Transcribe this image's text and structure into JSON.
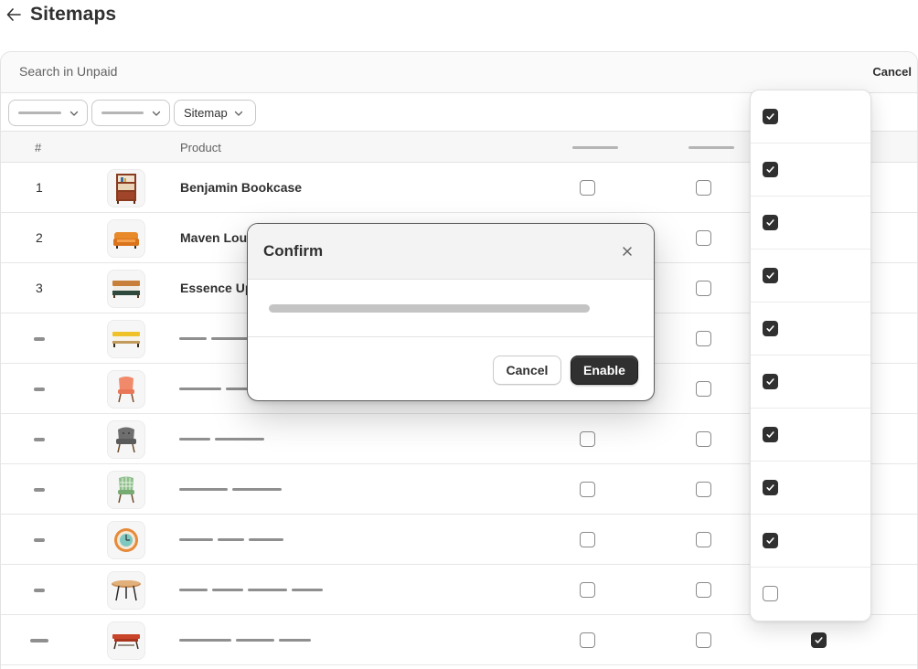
{
  "header": {
    "back_icon": "arrow-left-icon",
    "title": "Sitemaps"
  },
  "search": {
    "placeholder": "Search in Unpaid",
    "cancel_label": "Cancel"
  },
  "filters": [
    {
      "label": ""
    },
    {
      "label": ""
    },
    {
      "label": "Sitemap"
    }
  ],
  "table": {
    "columns": {
      "number": "#",
      "product": "Product"
    },
    "rows": [
      {
        "number": "1",
        "name": "Benjamin Bookcase",
        "thumb": "bookcase",
        "col1_checked": false,
        "col2_checked": false
      },
      {
        "number": "2",
        "name": "Maven Lounge Sofa",
        "thumb": "sofa",
        "col1_checked": false,
        "col2_checked": false
      },
      {
        "number": "3",
        "name": "Essence Upholstered Bed",
        "thumb": "bed-green",
        "col1_checked": false,
        "col2_checked": false
      },
      {
        "number": "",
        "name": "",
        "thumb": "bed-yellow",
        "col1_checked": false,
        "col2_checked": false
      },
      {
        "number": "",
        "name": "",
        "thumb": "chair-pink",
        "col1_checked": false,
        "col2_checked": false
      },
      {
        "number": "",
        "name": "",
        "thumb": "chair-grey",
        "col1_checked": false,
        "col2_checked": false
      },
      {
        "number": "",
        "name": "",
        "thumb": "chair-check",
        "col1_checked": false,
        "col2_checked": false
      },
      {
        "number": "",
        "name": "",
        "thumb": "clock",
        "col1_checked": false,
        "col2_checked": false
      },
      {
        "number": "",
        "name": "",
        "thumb": "table-round",
        "col1_checked": false,
        "col2_checked": false
      },
      {
        "number": "",
        "name": "",
        "thumb": "coffee-table",
        "col1_checked": false,
        "col2_checked": false,
        "col3_checked": true
      }
    ]
  },
  "dropdown": {
    "items": [
      {
        "checked": true
      },
      {
        "checked": true
      },
      {
        "checked": true
      },
      {
        "checked": true
      },
      {
        "checked": true
      },
      {
        "checked": true
      },
      {
        "checked": true
      },
      {
        "checked": true
      },
      {
        "checked": true
      },
      {
        "checked": false
      }
    ]
  },
  "modal": {
    "title": "Confirm",
    "close_icon": "close-icon",
    "cancel_label": "Cancel",
    "confirm_label": "Enable"
  },
  "colors": {
    "primary_button": "#303030",
    "checkbox_checked": "#303030",
    "border": "#e3e3e3"
  }
}
